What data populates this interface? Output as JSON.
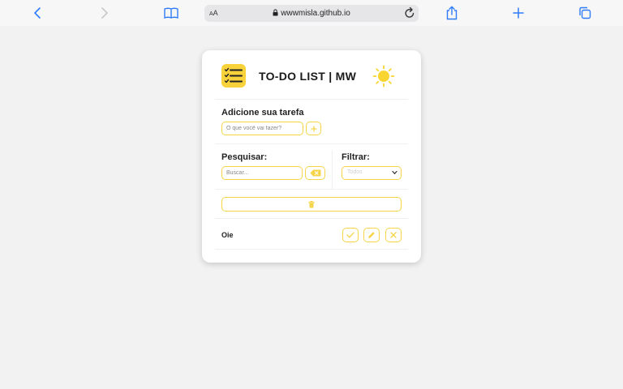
{
  "browser": {
    "url": "wwwmisla.github.io",
    "text_size_label": "AA",
    "icons": [
      "back-icon",
      "forward-icon",
      "bookmarks-icon",
      "lock-icon",
      "reload-icon",
      "share-icon",
      "new-tab-icon",
      "tabs-icon"
    ]
  },
  "app": {
    "title": "TO-DO LIST | MW",
    "add_label": "Adicione sua tarefa",
    "add_placeholder": "O que você vai fazer?",
    "search_label": "Pesquisar:",
    "search_placeholder": "Buscar...",
    "filter_label": "Filtrar:",
    "filter_value": "Todos",
    "filter_options": [
      "Todos"
    ],
    "todos": [
      {
        "text": "Oie"
      }
    ]
  },
  "colors": {
    "accent": "#f5d44a",
    "logo_bg": "#f8d23a",
    "sun": "#f9d532",
    "browser_icon": "#2f7cf6"
  }
}
